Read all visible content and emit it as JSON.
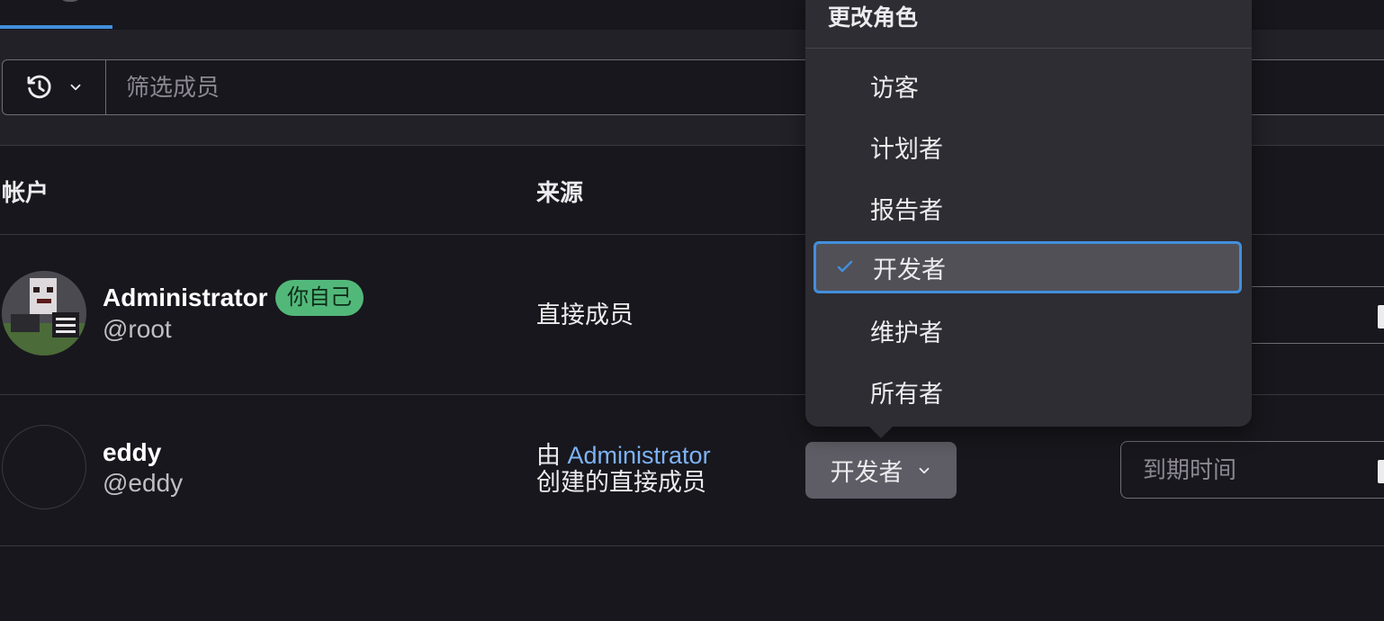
{
  "filter": {
    "placeholder": "筛选成员",
    "history_icon": "history-icon",
    "chevron_icon": "chevron-down-icon"
  },
  "table": {
    "headers": [
      "帐户",
      "来源"
    ]
  },
  "members": [
    {
      "name": "Administrator",
      "handle": "@root",
      "badge": "你自己",
      "source": "直接成员"
    },
    {
      "name": "eddy",
      "handle": "@eddy",
      "source_prefix": "由",
      "source_link": "Administrator",
      "source_suffix": "创建的直接成员",
      "role": "开发者",
      "expiry_placeholder": "到期时间"
    }
  ],
  "role_dropdown": {
    "title": "更改角色",
    "options": [
      "访客",
      "计划者",
      "报告者",
      "开发者",
      "维护者",
      "所有者"
    ],
    "selected": "开发者"
  },
  "colors": {
    "accent": "#428fdc",
    "badge": "#52b87a",
    "link": "#7db3f5"
  }
}
